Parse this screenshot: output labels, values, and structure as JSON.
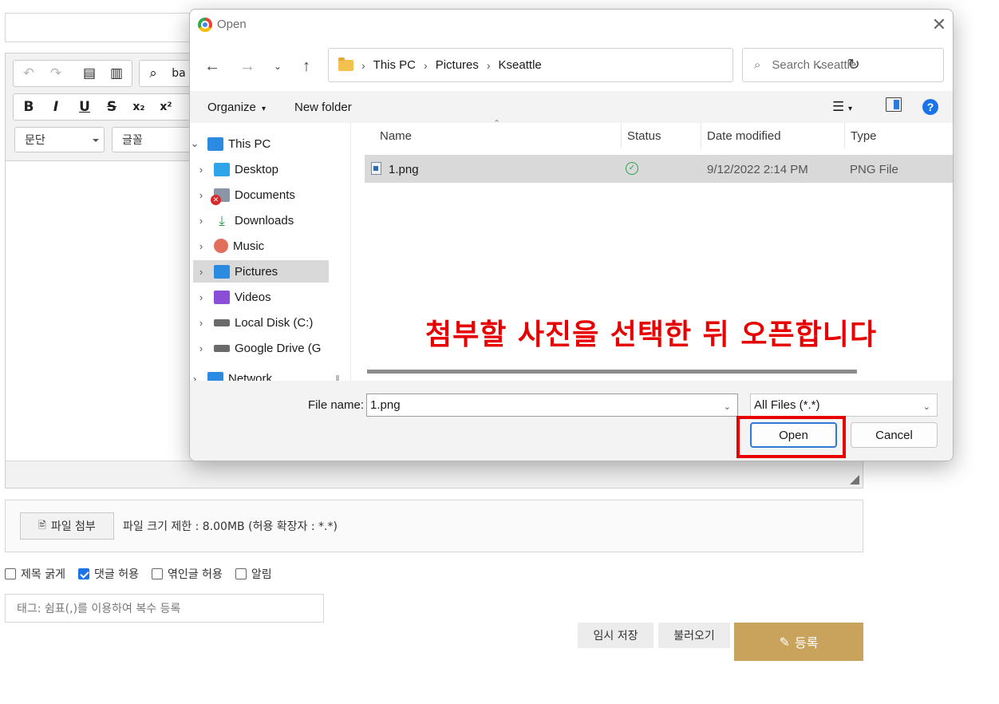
{
  "page": {
    "editor": {
      "format_select": "문단",
      "font_select": "글꼴"
    },
    "attach": {
      "button_label": "파일 첨부",
      "info": "파일 크기 제한 : 8.00MB (허용 확장자 : *.*)"
    },
    "options": [
      {
        "label": "제목 굵게",
        "checked": false
      },
      {
        "label": "댓글 허용",
        "checked": true
      },
      {
        "label": "엮인글 허용",
        "checked": false
      },
      {
        "label": "알림",
        "checked": false
      }
    ],
    "tags_placeholder": "태그: 쉼표(,)를 이용하여 복수 등록",
    "temp_save": "임시 저장",
    "load": "불러오기",
    "submit": "등록"
  },
  "dialog": {
    "title": "Open",
    "breadcrumb": [
      "This PC",
      "Pictures",
      "Kseattle"
    ],
    "search_placeholder": "Search Kseattle",
    "organize": "Organize",
    "new_folder": "New folder",
    "nav_items": [
      {
        "label": "This PC",
        "icon": "pc-icon",
        "color": "#2b8be0"
      },
      {
        "label": "Desktop",
        "icon": "desktop-icon",
        "color": "#2ea5e8"
      },
      {
        "label": "Documents",
        "icon": "documents-icon",
        "color": "#8a96a8"
      },
      {
        "label": "Downloads",
        "icon": "downloads-icon",
        "color": "#2e9f4f"
      },
      {
        "label": "Music",
        "icon": "music-icon",
        "color": "#e0705a"
      },
      {
        "label": "Pictures",
        "icon": "pictures-icon",
        "color": "#2b8be0"
      },
      {
        "label": "Videos",
        "icon": "videos-icon",
        "color": "#8a4fd6"
      },
      {
        "label": "Local Disk (C:)",
        "icon": "drive-icon",
        "color": "#6a6a6a"
      },
      {
        "label": "Google Drive (G",
        "icon": "drive-icon",
        "color": "#6a6a6a"
      },
      {
        "label": "Network",
        "icon": "network-icon",
        "color": "#2b8be0"
      }
    ],
    "columns": [
      "Name",
      "Status",
      "Date modified",
      "Type"
    ],
    "files": [
      {
        "name": "1.png",
        "status": "synced",
        "date": "9/12/2022 2:14 PM",
        "type": "PNG File"
      }
    ],
    "annotation": "첨부할 사진을 선택한 뒤 오픈합니다",
    "file_name_label": "File name:",
    "file_name_value": "1.png",
    "filter": "All Files (*.*)",
    "open": "Open",
    "cancel": "Cancel"
  },
  "colors": {
    "accent": "#c9a25c",
    "annotation_red": "#e60000",
    "win_blue": "#2f7ad6"
  }
}
